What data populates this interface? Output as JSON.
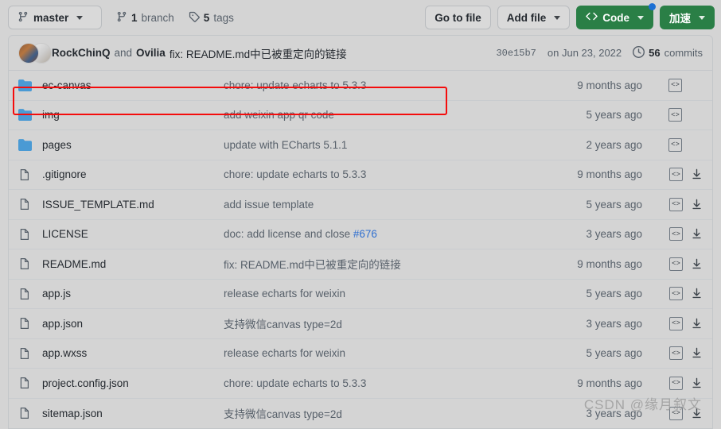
{
  "toolbar": {
    "branch_name": "master",
    "branch_icon": "git-branch-icon",
    "branch_count": "1",
    "branch_label": "branch",
    "tag_count": "5",
    "tag_label": "tags",
    "go_to_file": "Go to file",
    "add_file": "Add file",
    "code": "Code",
    "accelerate": "加速",
    "code_button_color": "#2a7f46",
    "badge_color": "#1c6fd4"
  },
  "commit": {
    "authors": "RockChinQ",
    "and": "and",
    "coauthor": "Ovilia",
    "message": "fix: README.md中已被重定向的链接",
    "sha": "30e15b7",
    "date": "on Jun 23, 2022",
    "commits_count": "56",
    "commits_label": "commits"
  },
  "files": [
    {
      "type": "folder",
      "name": "ec-canvas",
      "message": "chore: update echarts to 5.3.3",
      "time": "9 months ago",
      "has_download": false,
      "highlighted": true
    },
    {
      "type": "folder",
      "name": "img",
      "message": "add weixin app qr code",
      "time": "5 years ago",
      "has_download": false,
      "highlighted": false
    },
    {
      "type": "folder",
      "name": "pages",
      "message": "update with ECharts 5.1.1",
      "time": "2 years ago",
      "has_download": false,
      "highlighted": false
    },
    {
      "type": "file",
      "name": ".gitignore",
      "message": "chore: update echarts to 5.3.3",
      "time": "9 months ago",
      "has_download": true,
      "highlighted": false
    },
    {
      "type": "file",
      "name": "ISSUE_TEMPLATE.md",
      "message": "add issue template",
      "time": "5 years ago",
      "has_download": true,
      "highlighted": false
    },
    {
      "type": "file",
      "name": "LICENSE",
      "message": "doc: add license and close ",
      "issue": "#676",
      "time": "3 years ago",
      "has_download": true,
      "highlighted": false
    },
    {
      "type": "file",
      "name": "README.md",
      "message": "fix: README.md中已被重定向的链接",
      "time": "9 months ago",
      "has_download": true,
      "highlighted": false
    },
    {
      "type": "file",
      "name": "app.js",
      "message": "release echarts for weixin",
      "time": "5 years ago",
      "has_download": true,
      "highlighted": false
    },
    {
      "type": "file",
      "name": "app.json",
      "message": "支持微信canvas type=2d",
      "time": "3 years ago",
      "has_download": true,
      "highlighted": false
    },
    {
      "type": "file",
      "name": "app.wxss",
      "message": "release echarts for weixin",
      "time": "5 years ago",
      "has_download": true,
      "highlighted": false
    },
    {
      "type": "file",
      "name": "project.config.json",
      "message": "chore: update echarts to 5.3.3",
      "time": "9 months ago",
      "has_download": true,
      "highlighted": false
    },
    {
      "type": "file",
      "name": "sitemap.json",
      "message": "支持微信canvas type=2d",
      "time": "3 years ago",
      "has_download": true,
      "highlighted": false
    }
  ],
  "watermark": "CSDN @缘月叙文",
  "colors": {
    "folder_icon": "#4a9ad4",
    "annotation": "#f40c0c",
    "link": "#2f6fd0"
  }
}
